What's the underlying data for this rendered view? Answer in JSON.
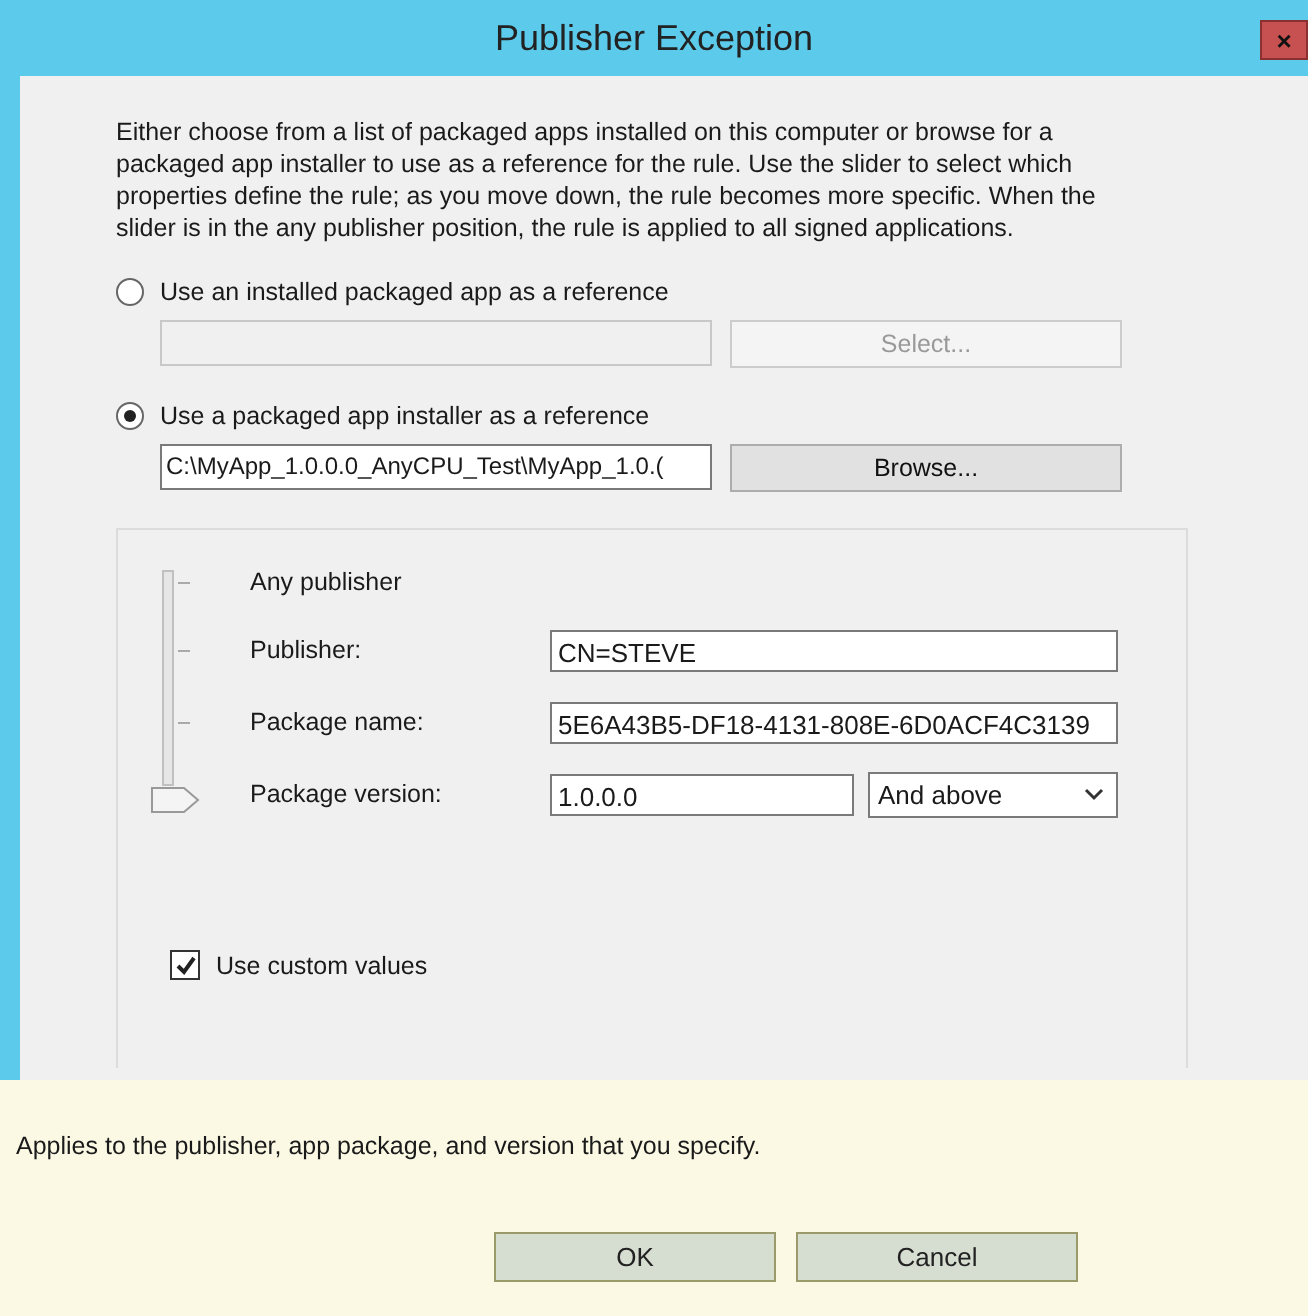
{
  "window": {
    "title": "Publisher Exception",
    "close": "×"
  },
  "intro": "Either choose from a list of packaged apps installed on this computer or browse for a packaged app installer to use as a reference for the rule. Use the slider to select which properties define the rule; as you move down, the rule becomes more specific. When the slider is in the any publisher position, the rule is applied to all signed applications.",
  "sources": [
    {
      "label": "Use an installed packaged app as a reference",
      "selected": false,
      "button": "Select..."
    },
    {
      "label": "Use a packaged app installer as a reference",
      "selected": true,
      "value": "C:\\MyApp_1.0.0.0_AnyCPU_Test\\MyApp_1.0.(",
      "button": "Browse..."
    }
  ],
  "properties": [
    {
      "kind": "label",
      "label": "Any publisher"
    },
    {
      "kind": "field",
      "label": "Publisher:",
      "value": "CN=STEVE"
    },
    {
      "kind": "field",
      "label": "Package name:",
      "value": "5E6A43B5-DF18-4131-808E-6D0ACF4C3139"
    },
    {
      "kind": "version",
      "label": "Package version:",
      "value": "1.0.0.0",
      "option": "And above"
    }
  ],
  "custom_values": {
    "label": "Use custom values",
    "checked": true
  },
  "rule_description": "Applies to the publisher, app package, and version that you specify.",
  "buttons": [
    "OK",
    "Cancel"
  ]
}
